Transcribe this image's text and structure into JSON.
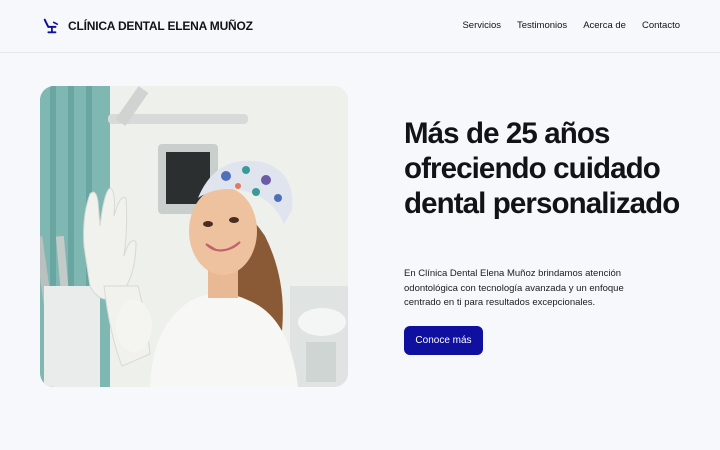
{
  "header": {
    "brand_name": "CLÍNICA DENTAL ELENA MUÑOZ",
    "brand_icon": "dental-chair-icon",
    "nav": [
      "Servicios",
      "Testimonios",
      "Acerca de",
      "Contacto"
    ]
  },
  "hero": {
    "title": "Más de 25 años ofreciendo cuidado dental personalizado",
    "description": "En Clínica Dental Elena Muñoz brindamos atención odontológica con tecnología avanzada y un enfoque centrado en ti para resultados excepcionales.",
    "cta_label": "Conoce más"
  },
  "colors": {
    "background": "#f7f8fc",
    "accent": "#0f0fa0",
    "text": "#121218"
  }
}
